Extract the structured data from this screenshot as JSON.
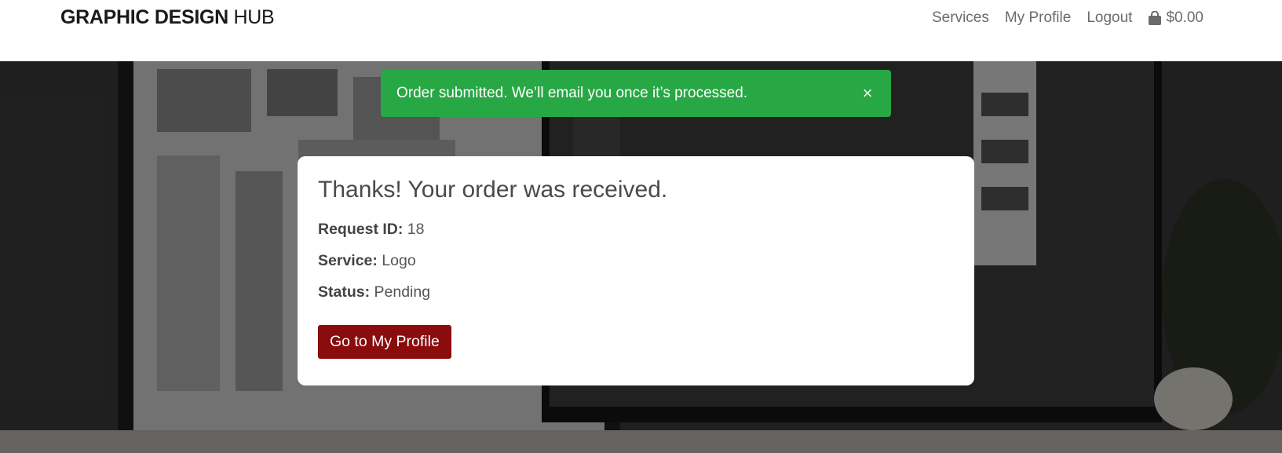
{
  "navbar": {
    "brand_bold": "GRAPHIC DESIGN",
    "brand_light": "HUB",
    "links": [
      "Services",
      "My Profile",
      "Logout"
    ],
    "cart_total": "$0.00"
  },
  "alert": {
    "message": "Order submitted. We’ll email you once it’s processed.",
    "close_symbol": "×",
    "color": "#28a745"
  },
  "confirmation": {
    "title": "Thanks! Your order was received.",
    "fields": [
      {
        "label": "Request ID:",
        "value": "18"
      },
      {
        "label": "Service:",
        "value": "Logo"
      },
      {
        "label": "Status:",
        "value": "Pending"
      }
    ],
    "button_label": "Go to My Profile",
    "button_color": "#8b0c0c"
  },
  "icons": {
    "cart": "shopping-bag-icon",
    "close": "close-icon"
  }
}
